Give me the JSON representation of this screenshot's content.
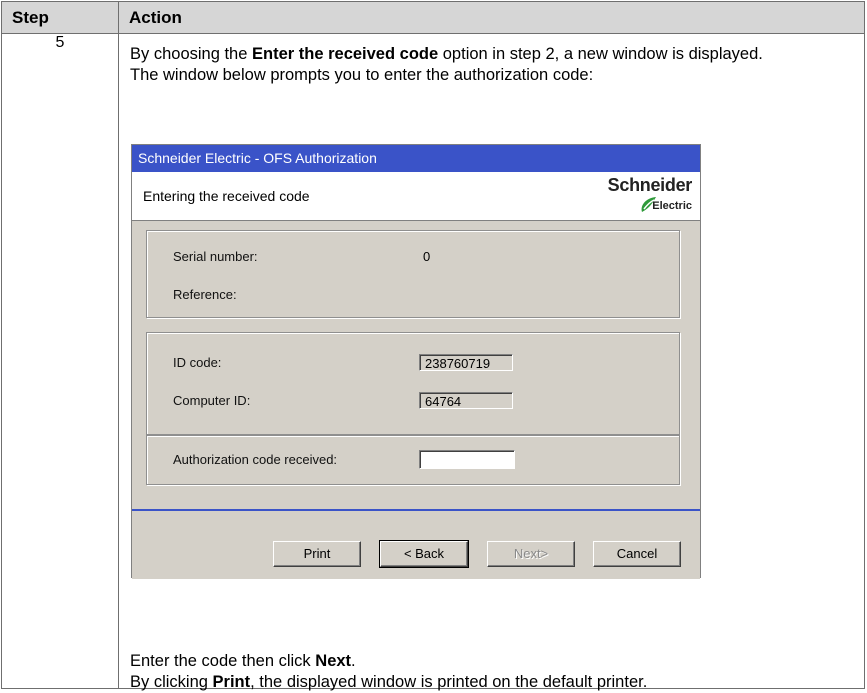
{
  "table": {
    "header_step": "Step",
    "header_action": "Action",
    "step_number": "5"
  },
  "intro": {
    "line1_before": "By choosing the ",
    "line1_bold": "Enter the received code",
    "line1_after": " option in step 2, a new window is displayed.",
    "line2": "The window below prompts you to enter the authorization code:"
  },
  "dialog": {
    "title": "Schneider Electric - OFS Authorization",
    "header_title": "Entering the received code",
    "logo_line1": "Schneider",
    "logo_line2": "Electric",
    "serial_label": "Serial number:",
    "serial_value": "0",
    "reference_label": "Reference:",
    "id_code_label": "ID code:",
    "id_code_value": "238760719",
    "computer_id_label": "Computer ID:",
    "computer_id_value": "64764",
    "auth_label": "Authorization code received:",
    "auth_value": "",
    "buttons": {
      "print": "Print",
      "back": "< Back",
      "next": "Next>",
      "cancel": "Cancel"
    },
    "colors": {
      "title_bar": "#3a53c8",
      "logo_green": "#2e9a3a"
    }
  },
  "outro": {
    "line1_before": "Enter the code then click ",
    "line1_bold": "Next",
    "line1_after": ".",
    "line2_before": "By clicking ",
    "line2_bold": "Print",
    "line2_after": ", the displayed window is printed on the default printer."
  }
}
